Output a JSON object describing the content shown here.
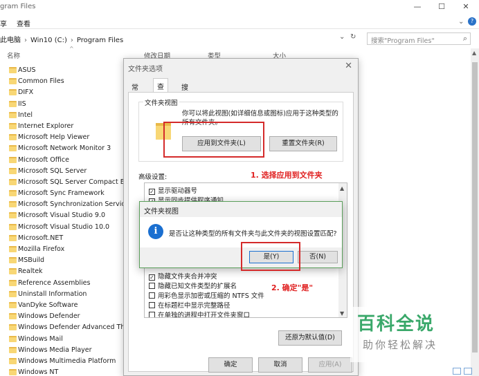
{
  "window": {
    "title": "gram Files"
  },
  "window_controls": [
    "—",
    "☐",
    "✕"
  ],
  "ribbon": {
    "tab_left": "享",
    "tab_view": "查看",
    "help": "?"
  },
  "address": {
    "crumbs": [
      "此电脑",
      "Win10 (C:)",
      "Program Files"
    ],
    "search_placeholder": "搜索\"Program Files\""
  },
  "columns": {
    "name": "名称",
    "date": "修改日期",
    "type": "类型",
    "size": "大小"
  },
  "folders": [
    "ASUS",
    "Common Files",
    "DIFX",
    "IIS",
    "Intel",
    "Internet Explorer",
    "Microsoft Help Viewer",
    "Microsoft Network Monitor 3",
    "Microsoft Office",
    "Microsoft SQL Server",
    "Microsoft SQL Server Compact Ed",
    "Microsoft Sync Framework",
    "Microsoft Synchronization Services",
    "Microsoft Visual Studio 9.0",
    "Microsoft Visual Studio 10.0",
    "Microsoft.NET",
    "Mozilla Firefox",
    "MSBuild",
    "Realtek",
    "Reference Assemblies",
    "Uninstall Information",
    "VanDyke Software",
    "Windows Defender",
    "Windows Defender Advanced Thr",
    "Windows Mail",
    "Windows Media Player",
    "Windows Multimedia Platform",
    "Windows NT"
  ],
  "folder_options": {
    "title": "文件夹选项",
    "tabs": [
      "常规",
      "查看",
      "搜索"
    ],
    "group_label": "文件夹视图",
    "group_desc": "你可以将此视图(如详细信息或图标)应用于这种类型的所有文件夹。",
    "apply_button": "应用到文件夹(L)",
    "reset_button": "重置文件夹(R)",
    "advanced_label": "高级设置:",
    "tree_items_top": [
      {
        "label": "显示驱动器号",
        "checked": true
      },
      {
        "label": "显示同步提供程序通知",
        "checked": true
      }
    ],
    "tree_items_bottom": [
      {
        "label": "隐藏文件夹合并冲突",
        "checked": true
      },
      {
        "label": "隐藏已知文件类型的扩展名",
        "checked": false
      },
      {
        "label": "用彩色显示加密或压缩的 NTFS 文件",
        "checked": false
      },
      {
        "label": "在标题栏中显示完整路径",
        "checked": false
      },
      {
        "label": "在单独的进程中打开文件夹窗口",
        "checked": false
      }
    ],
    "restore_defaults": "还原为默认值(D)",
    "ok": "确定",
    "cancel": "取消",
    "apply": "应用(A)"
  },
  "confirm": {
    "title": "文件夹视图",
    "message": "是否让这种类型的所有文件夹与此文件夹的视图设置匹配?",
    "yes": "是(Y)",
    "no": "否(N)"
  },
  "annotations": {
    "step1": "1. 选择应用到文件夹",
    "step2": "2. 确定\"是\""
  },
  "watermark": {
    "main": "百科全说",
    "sub": "助你轻松解决"
  },
  "colors": {
    "annotation_red": "#d42a2a",
    "watermark_green": "#3aa86a",
    "info_blue": "#1a6fd0"
  }
}
